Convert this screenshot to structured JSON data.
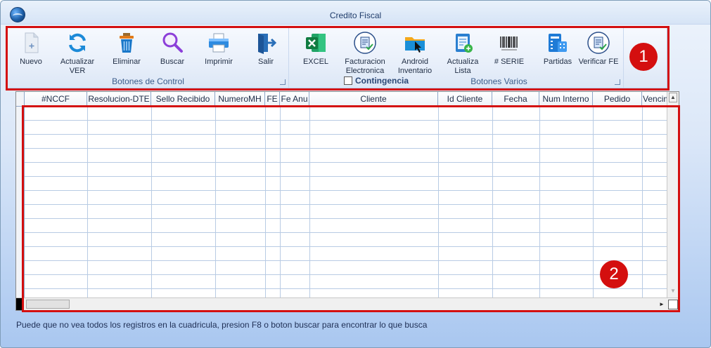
{
  "window": {
    "title": "Credito Fiscal"
  },
  "ribbon": {
    "groups": [
      {
        "label": "Botones de Control",
        "buttons": [
          {
            "label": "Nuevo",
            "icon": "new-document-icon"
          },
          {
            "label": "Actualizar",
            "label2": "VER",
            "icon": "refresh-icon"
          },
          {
            "label": "Eliminar",
            "icon": "trash-icon"
          },
          {
            "label": "Buscar",
            "icon": "magnifier-icon"
          },
          {
            "label": "Imprimir",
            "icon": "printer-icon"
          },
          {
            "label": "Salir",
            "icon": "exit-door-icon"
          }
        ]
      },
      {
        "label": "Botones Varios",
        "buttons": [
          {
            "label": "EXCEL",
            "icon": "excel-icon"
          },
          {
            "label": "Facturacion",
            "label2": "Electronica",
            "icon": "electronic-invoice-icon"
          },
          {
            "label": "Android",
            "label2": "Inventario",
            "icon": "folder-pointer-icon"
          },
          {
            "label": "Actualiza",
            "label2": "Lista",
            "icon": "update-list-icon"
          },
          {
            "label": "# SERIE",
            "icon": "barcode-icon"
          },
          {
            "label": "Partidas",
            "icon": "calculator-list-icon"
          },
          {
            "label": "Verificar FE",
            "icon": "verify-invoice-icon"
          }
        ],
        "checkbox": {
          "label": "Contingencia",
          "checked": false
        }
      }
    ]
  },
  "grid": {
    "columns": [
      "#NCCF",
      "Resolucion-DTE",
      "Sello Recibido",
      "NumeroMH",
      "FE",
      "Fe Anu",
      "Cliente",
      "Id Cliente",
      "Fecha",
      "Num Interno",
      "Pedido",
      "Vencim"
    ],
    "rows": []
  },
  "annotations": {
    "badge1": "1",
    "badge2": "2"
  },
  "status": {
    "message": "Puede que no vea todos los registros en la cuadricula, presion F8 o boton buscar para encontrar lo que busca"
  },
  "colors": {
    "highlight": "#d40f0f",
    "window_gradient_bottom": "#a9c7f0"
  }
}
